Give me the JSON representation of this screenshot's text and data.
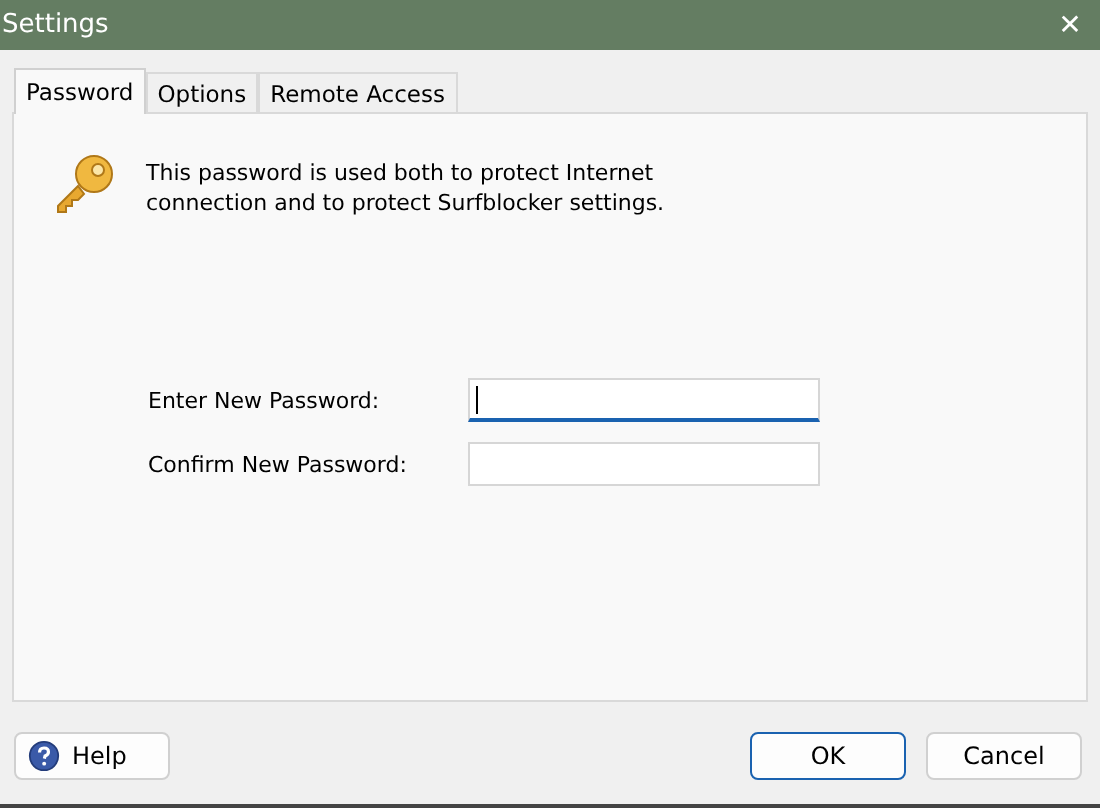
{
  "window": {
    "title": "Settings",
    "close": "✕"
  },
  "tabs": [
    {
      "label": "Password",
      "selected": true
    },
    {
      "label": "Options",
      "selected": false
    },
    {
      "label": "Remote Access",
      "selected": false
    }
  ],
  "message": "This password is used both to protect Internet connection and to protect Surfblocker settings.",
  "fields": [
    {
      "label": "Enter New Password:",
      "focused": true
    },
    {
      "label": "Confirm New Password:",
      "focused": false
    }
  ],
  "buttons": [
    {
      "label": "Help",
      "kind": "help"
    },
    {
      "label": "OK",
      "kind": "default"
    },
    {
      "label": "Cancel",
      "kind": "plain"
    }
  ]
}
